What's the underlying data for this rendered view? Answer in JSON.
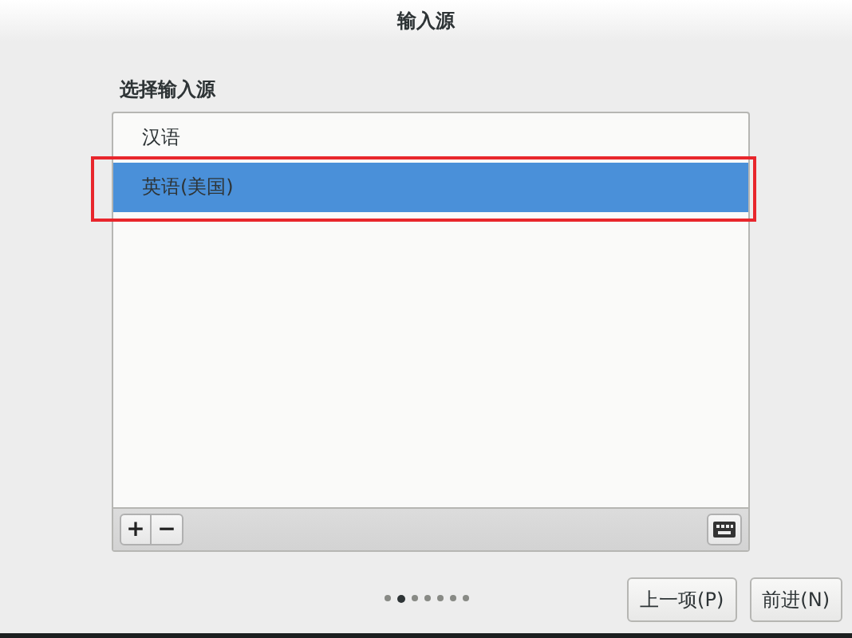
{
  "window": {
    "title": "输入源"
  },
  "heading": "选择输入源",
  "sources": [
    {
      "label": "汉语",
      "selected": false
    },
    {
      "label": "英语(美国)",
      "selected": true
    }
  ],
  "toolbar": {
    "add": "+",
    "remove": "−"
  },
  "pages": [
    {
      "selected": false
    },
    {
      "selected": true
    },
    {
      "selected": false
    },
    {
      "selected": false
    },
    {
      "selected": false
    },
    {
      "selected": false
    },
    {
      "selected": false
    }
  ],
  "buttons": [
    {
      "label": "上一项(P)"
    },
    {
      "label": "前进(N)"
    }
  ]
}
